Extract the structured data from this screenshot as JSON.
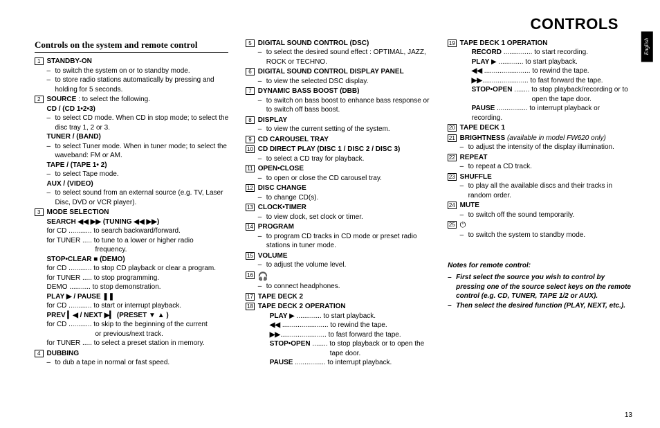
{
  "pageTitle": "CONTROLS",
  "langTab": "English",
  "sectionHeading": "Controls on the system and remote control",
  "pageNum": "13",
  "notes": {
    "heading": "Notes for remote control:",
    "lines": [
      "First select the source you wish to control by pressing one of the source select keys on the remote control (e.g.  CD, TUNER, TAPE 1/2 or AUX).",
      "Then select the desired function (PLAY, NEXT, etc.)."
    ]
  },
  "col1": {
    "i1": {
      "title": "STANDBY-ON",
      "l1": "to switch the system on or to standby mode.",
      "l2": "to store radio stations automatically by pressing and holding for 5 seconds."
    },
    "i2": {
      "title1": "SOURCE",
      "title1b": " : to select the following.",
      "h1": "CD / (CD 1•2•3)",
      "l1": "to select CD mode. When CD in stop mode; to select the disc tray 1, 2 or 3.",
      "h2": "TUNER / (BAND)",
      "l2": "to select Tuner mode. When in tuner mode; to select the waveband: FM or AM.",
      "h3": "TAPE / (TAPE 1• 2)",
      "l3": "to select Tape mode.",
      "h4": "AUX /  (VIDEO)",
      "l4": "to select sound from an external source (e.g. TV, Laser Disc, DVD or VCR player)."
    },
    "i3": {
      "title": "MODE SELECTION",
      "h1a": "SEARCH ",
      "h1b": " (TUNING ",
      "h1c": ")",
      "s1": "for CD ............ to search backward/forward.",
      "s2": "for TUNER ..... to tune to a lower or higher radio",
      "s2b": "frequency.",
      "h2a": "STOP•CLEAR ",
      "h2b": " (DEMO)",
      "s3": "for CD ............ to stop CD playback or clear a program.",
      "s4": "for TUNER ..... to stop programming.",
      "s5": "DEMO ........... to stop demonstration.",
      "h3a": "PLAY ",
      "h3b": "  /  PAUSE ",
      "s6": "for CD ............ to start or interrupt playback.",
      "h4a": "PREV ",
      "h4b": " / NEXT ",
      "h4c": " (PRESET ",
      "h4d": " )",
      "s7": "for CD ............ to skip to the beginning of the current",
      "s7b": "or previous/next track.",
      "s8": "for TUNER ..... to select a preset station in memory."
    },
    "i4": {
      "title": "DUBBING",
      "l1": "to dub a tape in normal or fast speed."
    }
  },
  "col2": {
    "i5": {
      "title": "DIGITAL SOUND CONTROL  (DSC)",
      "l1": "to select the desired sound effect : OPTIMAL, JAZZ, ROCK or TECHNO."
    },
    "i6": {
      "title": "DIGITAL SOUND CONTROL DISPLAY PANEL",
      "l1": "to view the selected DSC display."
    },
    "i7": {
      "title": "DYNAMIC BASS BOOST  (DBB)",
      "l1": "to switch on bass boost to enhance bass response or to switch off bass boost."
    },
    "i8": {
      "title": "DISPLAY",
      "l1": "to view the current setting of the system."
    },
    "i9": {
      "title": "CD CAROUSEL TRAY"
    },
    "i10": {
      "title": "CD DIRECT PLAY (DISC 1 / DISC 2 / DISC 3)",
      "l1": "to select a CD tray for playback."
    },
    "i11": {
      "title": "OPEN•CLOSE",
      "l1": "to open or close the CD carousel tray."
    },
    "i12": {
      "title": "DISC CHANGE",
      "l1": "to change CD(s)."
    },
    "i13": {
      "title": "CLOCK•TIMER",
      "l1": "to view clock, set clock or timer."
    },
    "i14": {
      "title": "PROGRAM",
      "l1": "to program CD tracks in CD mode or preset radio stations in tuner mode."
    },
    "i15": {
      "title": "VOLUME",
      "l1": "to adjust the volume level."
    },
    "i16": {
      "l1": "to connect headphones."
    },
    "i17": {
      "title": "TAPE DECK 2"
    },
    "i18": {
      "title": "TAPE DECK 2 OPERATION",
      "s1a": "PLAY  ",
      "s1b": " ............. to start playback.",
      "s2a": "",
      "s2b": " ........................ to rewind the tape.",
      "s3a": "",
      "s3b": "........................ to fast forward the tape.",
      "s4a": "STOP•OPEN",
      "s4b": " ........ to stop playback or to open the",
      "s4c": "tape door.",
      "s5a": "PAUSE",
      "s5b": " ................ to interrupt playback."
    }
  },
  "col3": {
    "i19": {
      "title": "TAPE DECK 1 OPERATION",
      "s1a": "RECORD",
      "s1b": " ............... to start recording.",
      "s2a": "PLAY  ",
      "s2b": " ............. to start playback.",
      "s3a": "",
      "s3b": " ........................ to rewind the tape.",
      "s4a": "",
      "s4b": "........................ to fast forward the tape.",
      "s5a": "STOP•OPEN",
      "s5b": " ........ to stop playback/recording or to",
      "s5c": "open the tape door.",
      "s6a": "PAUSE",
      "s6b": " ................ to interrupt playback or recording."
    },
    "i20": {
      "title": "TAPE DECK 1"
    },
    "i21": {
      "title": "BRIGHTNESS",
      "titleNote": "  (available in model FW620 only)",
      "l1": "to adjust the intensity of the display illumination."
    },
    "i22": {
      "title": "REPEAT",
      "l1": "to repeat a CD track."
    },
    "i23": {
      "title": "SHUFFLE",
      "l1": "to play all the available discs and their tracks in random order."
    },
    "i24": {
      "title": "MUTE",
      "l1": "to switch off the sound temporarily."
    },
    "i25": {
      "l1": "to switch the system to standby mode."
    }
  }
}
